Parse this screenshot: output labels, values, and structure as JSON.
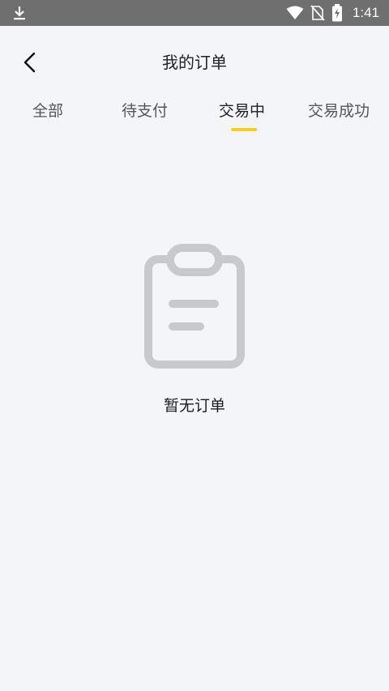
{
  "status_bar": {
    "time": "1:41",
    "icons": [
      "download-icon",
      "wifi-icon",
      "no-sim-icon",
      "battery-charging-icon"
    ]
  },
  "header": {
    "title": "我的订单",
    "back_icon": "chevron-left-icon"
  },
  "tabs": [
    {
      "label": "全部",
      "active": false
    },
    {
      "label": "待支付",
      "active": false
    },
    {
      "label": "交易中",
      "active": true
    },
    {
      "label": "交易成功",
      "active": false
    }
  ],
  "empty_state": {
    "icon": "clipboard-icon",
    "message": "暂无订单"
  },
  "colors": {
    "accent": "#f6cf16",
    "background": "#f4f5f9",
    "status_bar": "#6f6f6f",
    "icon_gray": "#c8c9cc"
  }
}
